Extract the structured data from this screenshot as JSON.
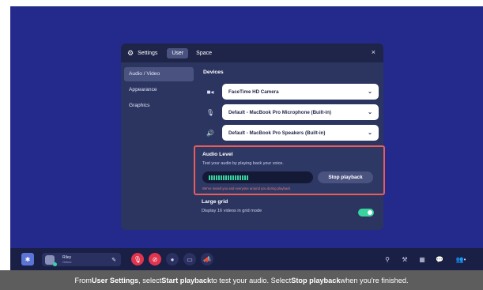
{
  "settings": {
    "title": "Settings",
    "tabs": [
      "User",
      "Space"
    ],
    "active_tab": "User",
    "close_label": "×",
    "sidebar": [
      "Audio / Video",
      "Appearance",
      "Graphics"
    ],
    "devices_title": "Devices",
    "camera": "FaceTime HD Camera",
    "microphone": "Default - MacBook Pro Microphone (Built-in)",
    "speakers": "Default - MacBook Pro Speakers (Built-in)",
    "audio_level_title": "Audio Level",
    "audio_level_desc": "Test your audio by playing back your voice.",
    "audio_meter_level": 0.4,
    "stop_playback_label": "Stop playback",
    "muted_note": "We've muted you and everyone around you during playback",
    "large_grid_title": "Large grid",
    "large_grid_desc": "Display 16 videos in grid mode",
    "large_grid_enabled": true
  },
  "toolbar": {
    "user_name": "Riley",
    "user_status": "Online",
    "accent": "#38d39f",
    "mute_color": "#e0344f"
  },
  "caption": {
    "pre1": "From ",
    "b1": "User Settings",
    "mid1": ", select ",
    "b2": "Start playback",
    "mid2": " to test your audio. Select ",
    "b3": "Stop playback",
    "post": " when you're finished."
  }
}
